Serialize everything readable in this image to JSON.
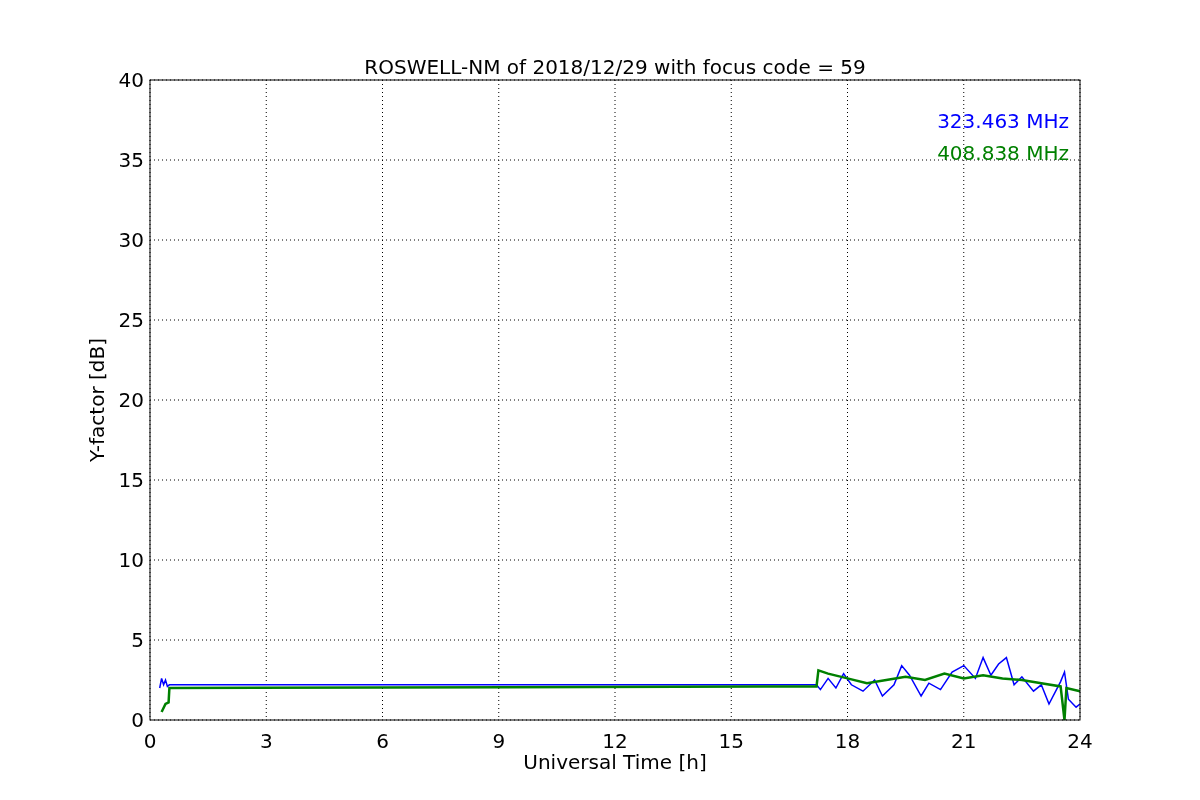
{
  "chart_data": {
    "type": "line",
    "grid": true,
    "title": "ROSWELL-NM of 2018/12/29 with focus code = 59",
    "xlabel": "Universal Time [h]",
    "ylabel": "Y-factor [dB]",
    "xlim": [
      0,
      24
    ],
    "ylim": [
      0,
      40
    ],
    "xticks": [
      0,
      3,
      6,
      9,
      12,
      15,
      18,
      21,
      24
    ],
    "yticks": [
      0,
      5,
      10,
      15,
      20,
      25,
      30,
      35,
      40
    ],
    "series": [
      {
        "name": "323.463 MHz",
        "color": "#0000ff",
        "x": [
          0.25,
          0.3,
          0.35,
          0.4,
          0.45,
          0.5,
          17.2,
          17.3,
          17.5,
          17.7,
          17.9,
          18.1,
          18.4,
          18.7,
          18.9,
          19.2,
          19.4,
          19.6,
          19.9,
          20.1,
          20.4,
          20.7,
          21.0,
          21.3,
          21.5,
          21.7,
          21.9,
          22.1,
          22.3,
          22.5,
          22.8,
          23.0,
          23.2,
          23.5,
          23.6,
          23.7,
          23.9,
          24.0
        ],
        "values": [
          2.0,
          2.6,
          2.2,
          2.5,
          2.1,
          2.2,
          2.2,
          1.9,
          2.6,
          2.0,
          2.9,
          2.2,
          1.8,
          2.5,
          1.5,
          2.2,
          3.4,
          2.8,
          1.5,
          2.3,
          1.9,
          3.0,
          3.4,
          2.6,
          3.9,
          2.8,
          3.5,
          3.9,
          2.2,
          2.7,
          1.8,
          2.2,
          1.0,
          2.4,
          3.0,
          1.3,
          0.8,
          1.0
        ]
      },
      {
        "name": "408.838 MHz",
        "color": "#008000",
        "x": [
          0.3,
          0.4,
          0.48,
          0.5,
          17.2,
          17.25,
          17.5,
          18,
          18.5,
          19,
          19.5,
          20,
          20.5,
          21,
          21.5,
          22,
          22.5,
          23,
          23.5,
          23.6,
          23.65,
          24
        ],
        "values": [
          0.5,
          1.0,
          1.1,
          2.0,
          2.1,
          3.1,
          2.9,
          2.6,
          2.3,
          2.5,
          2.7,
          2.5,
          2.9,
          2.6,
          2.8,
          2.6,
          2.5,
          2.3,
          2.1,
          0,
          2.0,
          1.8
        ]
      }
    ]
  }
}
